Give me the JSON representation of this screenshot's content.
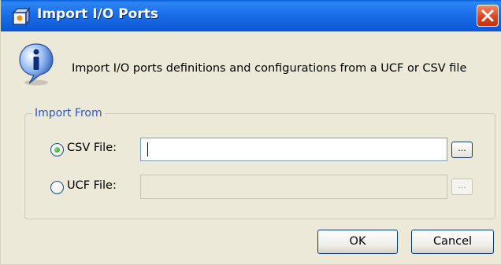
{
  "window": {
    "title": "Import I/O Ports",
    "icons": {
      "app": "app-cube-icon",
      "close": "close-icon"
    }
  },
  "info": {
    "icon": "info-icon",
    "message": "Import I/O ports definitions and configurations from a UCF or CSV file"
  },
  "import_group": {
    "title": "Import From",
    "options": [
      {
        "label": "CSV File:",
        "selected": true,
        "value": "",
        "enabled": true,
        "browse_label": "..."
      },
      {
        "label": "UCF File:",
        "selected": false,
        "value": "",
        "enabled": false,
        "browse_label": "..."
      }
    ]
  },
  "buttons": {
    "ok": "OK",
    "cancel": "Cancel"
  },
  "colors": {
    "titlebar": "#0c58d4",
    "dialog_bg": "#ece9d8",
    "group_title": "#2e58b8",
    "radio_dot": "#1f9a1f"
  }
}
